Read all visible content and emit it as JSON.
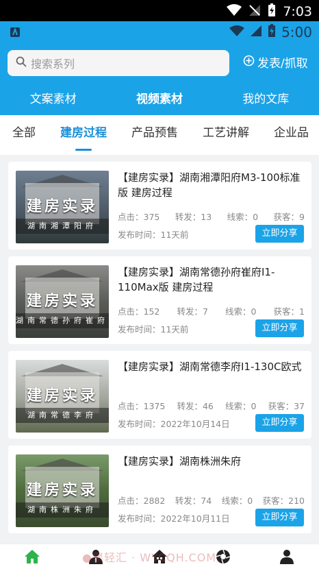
{
  "system_bar": {
    "time": "7:03"
  },
  "app_status": {
    "time": "5:00"
  },
  "header": {
    "search_placeholder": "搜索系列",
    "post_label": "发表/抓取",
    "main_tabs": [
      {
        "label": "文案素材",
        "active": false
      },
      {
        "label": "视频素材",
        "active": true
      },
      {
        "label": "我的文库",
        "active": false
      }
    ]
  },
  "sub_tabs": [
    {
      "label": "全部",
      "active": false
    },
    {
      "label": "建房过程",
      "active": true
    },
    {
      "label": "产品预售",
      "active": false
    },
    {
      "label": "工艺讲解",
      "active": false
    },
    {
      "label": "企业品",
      "active": false
    }
  ],
  "cards": [
    {
      "thumb_title": "建房实录",
      "thumb_sub": "湖南湘潭阳府",
      "title": "【建房实录】湖南湘潭阳府M3-100标准版 建房过程",
      "clicks": "点击：375",
      "shares": "转发：13",
      "leads": "线索：0",
      "customers": "获客：9",
      "date": "发布时间：11天前",
      "button": "立即分享"
    },
    {
      "thumb_title": "建房实录",
      "thumb_sub": "湖南常德孙府崔府",
      "title": "【建房实录】湖南常德孙府崔府I1-110Max版 建房过程",
      "clicks": "点击：152",
      "shares": "转发：7",
      "leads": "线索：0",
      "customers": "获客：1",
      "date": "发布时间：11天前",
      "button": "立即分享"
    },
    {
      "thumb_title": "建房实录",
      "thumb_sub": "湖南常德李府",
      "title": "【建房实录】湖南常德李府I1-130C欧式",
      "clicks": "点击：1375",
      "shares": "转发：46",
      "leads": "线索：0",
      "customers": "获客：37",
      "date": "发布时间：2022年10月14日",
      "button": "立即分享"
    },
    {
      "thumb_title": "建房实录",
      "thumb_sub": "湖南株洲朱府",
      "title": "【建房实录】湖南株洲朱府",
      "clicks": "点击：2882",
      "shares": "转发：74",
      "leads": "线索：0",
      "customers": "获客：210",
      "date": "发布时间：2022年10月11日",
      "button": "立即分享"
    }
  ],
  "watermark": "●聚轻汇 · WYCQH.COM",
  "colors": {
    "primary": "#1ba3e8",
    "tab_active": "#1b8fd9",
    "home_active": "#2db34a"
  }
}
